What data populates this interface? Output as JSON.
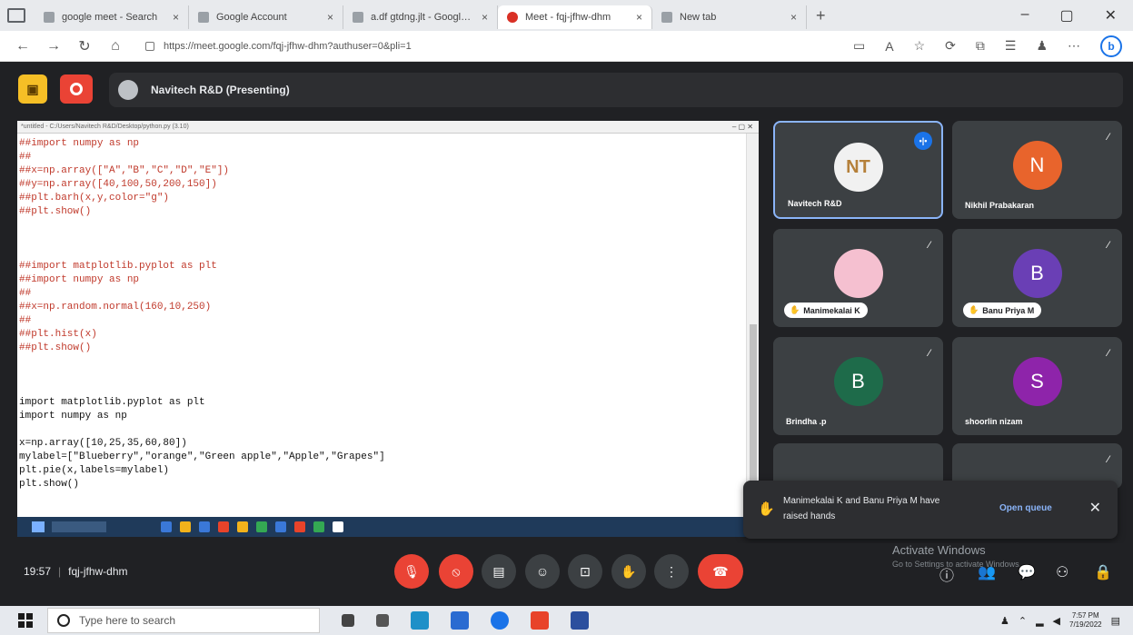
{
  "browser": {
    "tabs": [
      {
        "title": "google meet - Search"
      },
      {
        "title": "Google Account"
      },
      {
        "title": "a.df gtdng.jlt - Google Drv"
      },
      {
        "title": "Meet - fqj-jfhw-dhm"
      },
      {
        "title": "New tab"
      }
    ],
    "url": "https://meet.google.com/fqj-jfhw-dhm?authuser=0&pli=1",
    "profile_initial": "b"
  },
  "meet": {
    "presenting_label": "Navitech R&D (Presenting)",
    "time": "19:57",
    "meeting_code": "fqj-jfhw-dhm"
  },
  "editor": {
    "title": "*untitled - C:/Users/Navitech R&D/Desktop/python.py (3.10)",
    "lines": [
      {
        "t": "##import numpy as np",
        "c": "c-comment"
      },
      {
        "t": "##",
        "c": "c-comment"
      },
      {
        "t": "##x=np.array([\"A\",\"B\",\"C\",\"D\",\"E\"])",
        "c": "c-comment"
      },
      {
        "t": "##y=np.array([40,100,50,200,150])",
        "c": "c-comment"
      },
      {
        "t": "##plt.barh(x,y,color=\"g\")",
        "c": "c-comment"
      },
      {
        "t": "##plt.show()",
        "c": "c-comment"
      },
      {
        "t": "",
        "c": "c-plain"
      },
      {
        "t": "",
        "c": "c-plain"
      },
      {
        "t": "",
        "c": "c-plain"
      },
      {
        "t": "##import matplotlib.pyplot as plt",
        "c": "c-comment"
      },
      {
        "t": "##import numpy as np",
        "c": "c-comment"
      },
      {
        "t": "##",
        "c": "c-comment"
      },
      {
        "t": "##x=np.random.normal(160,10,250)",
        "c": "c-comment"
      },
      {
        "t": "##",
        "c": "c-comment"
      },
      {
        "t": "##plt.hist(x)",
        "c": "c-comment"
      },
      {
        "t": "##plt.show()",
        "c": "c-comment"
      },
      {
        "t": "",
        "c": "c-plain"
      },
      {
        "t": "",
        "c": "c-plain"
      },
      {
        "t": "",
        "c": "c-plain"
      },
      {
        "t": "import matplotlib.pyplot as plt",
        "c": "c-plain"
      },
      {
        "t": "import numpy as np",
        "c": "c-plain"
      },
      {
        "t": "",
        "c": "c-plain"
      },
      {
        "t": "x=np.array([10,25,35,60,80])",
        "c": "c-plain"
      },
      {
        "t": "mylabel=[\"Blueberry\",\"orange\",\"Green apple\",\"Apple\",\"Grapes\"]",
        "c": "c-plain"
      },
      {
        "t": "plt.pie(x,labels=mylabel)",
        "c": "c-plain"
      },
      {
        "t": "plt.show()",
        "c": "c-plain"
      }
    ]
  },
  "participants": [
    {
      "name": "Navitech R&D",
      "initial": "NT",
      "color": "#f1f1f1"
    },
    {
      "name": "Nikhil Prabakaran",
      "initial": "N",
      "color": "#e8642c"
    },
    {
      "name": "Manimekalai K",
      "initial": "",
      "color": "#f5c0d0"
    },
    {
      "name": "Banu Priya M",
      "initial": "B",
      "color": "#6a3fb5"
    },
    {
      "name": "Brindha .p",
      "initial": "B",
      "color": "#1e6b4a"
    },
    {
      "name": "shoorlin nizam",
      "initial": "S",
      "color": "#8e24aa"
    }
  ],
  "toast": {
    "message": "Manimekalai K and Banu Priya M have raised hands",
    "action": "Open queue"
  },
  "windows": {
    "activate_title": "Activate Windows",
    "activate_sub": "Go to Settings to activate Windows.",
    "search_placeholder": "Type here to search",
    "clock_time": "7:57 PM",
    "clock_date": "7/19/2022"
  },
  "icons": {
    "close": "×",
    "hand": "✋",
    "mic_off": "🎙"
  }
}
